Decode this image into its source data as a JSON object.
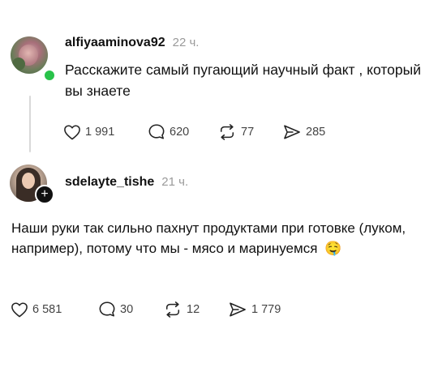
{
  "post1": {
    "username": "alfiyaaminova92",
    "time": "22 ч.",
    "text": "Расскажите самый пугающий научный факт , который вы знаете",
    "actions": {
      "likes": "1 991",
      "comments": "620",
      "reposts": "77",
      "shares": "285"
    }
  },
  "post2": {
    "username": "sdelayte_tishe",
    "time": "21 ч.",
    "text": "Наши руки так сильно пахнут продуктами при готовке (луком, например), потому что мы - мясо и маринуемся",
    "emoji": "🤤",
    "actions": {
      "likes": "6 581",
      "comments": "30",
      "reposts": "12",
      "shares": "1 779"
    }
  },
  "icons": {
    "like": "heart-icon",
    "comment": "comment-bubble-icon",
    "repost": "repost-icon",
    "share": "share-icon",
    "follow": "plus-icon"
  },
  "colors": {
    "online": "#29c24a",
    "text": "#111111",
    "muted": "#9a9a9a"
  }
}
